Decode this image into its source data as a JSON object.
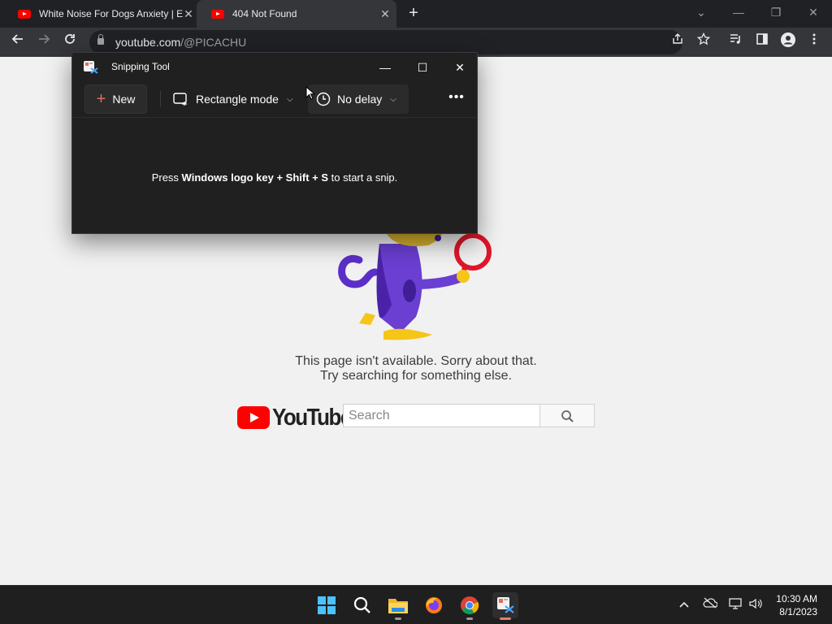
{
  "browser": {
    "tabs": [
      {
        "title": "White Noise For Dogs Anxiety | E",
        "active": false,
        "favicon": "youtube-icon"
      },
      {
        "title": "404 Not Found",
        "active": true,
        "favicon": "youtube-icon"
      }
    ],
    "url_host": "youtube.com",
    "url_path": "/@PICACHU"
  },
  "page": {
    "error_line1": "This page isn't available. Sorry about that.",
    "error_line2": "Try searching for something else.",
    "logo_text": "YouTube",
    "search_placeholder": "Search"
  },
  "snipping_tool": {
    "title": "Snipping Tool",
    "new_label": "New",
    "mode_label": "Rectangle mode",
    "delay_label": "No delay",
    "more_label": "•••",
    "hint_prefix": "Press ",
    "hint_keys": "Windows logo key + Shift + S",
    "hint_suffix": " to start a snip."
  },
  "taskbar": {
    "time": "10:30 AM",
    "date": "8/1/2023"
  },
  "colors": {
    "youtube_red": "#ff0000",
    "chrome_dark": "#202124",
    "snip_bg": "#202020",
    "accent_plus": "#e46c5c"
  }
}
